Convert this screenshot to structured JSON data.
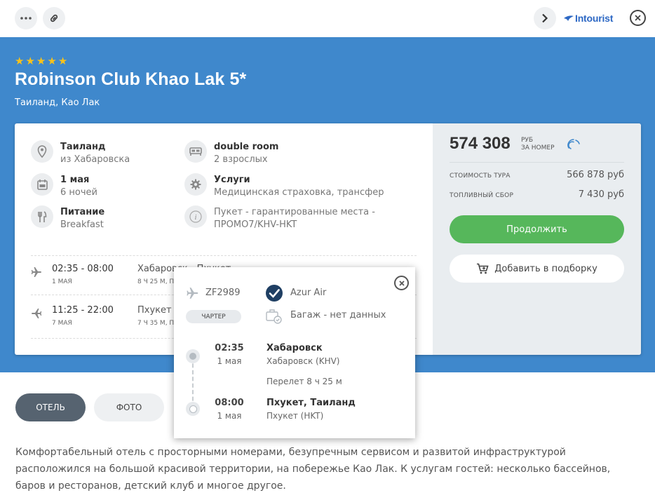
{
  "topbar": {
    "brand": "Intourist",
    "icons": [
      "more-icon",
      "link-icon",
      "chevron-right-icon",
      "close-icon"
    ]
  },
  "hotel": {
    "stars": [
      "★",
      "★",
      "★",
      "★",
      "★"
    ],
    "name": "Robinson Club Khao Lak 5*",
    "location": "Таиланд, Као Лак"
  },
  "info": {
    "country": {
      "title": "Таиланд",
      "sub": "из Хабаровска"
    },
    "room": {
      "title": "double room",
      "sub": "2 взрослых"
    },
    "date": {
      "title": "1 мая",
      "sub": "6 ночей"
    },
    "services": {
      "title": "Услуги",
      "sub": "Медицинская страховка, трансфер"
    },
    "meal": {
      "title": "Питание",
      "sub": "Breakfast"
    },
    "note": {
      "sub": "Пукет - гарантированные места - ПРОМО7/KHV-HKT"
    }
  },
  "flights": [
    {
      "time": "02:35 - 08:00",
      "date": "1 МАЯ",
      "route": "Хабаровск - Пхукет",
      "duration": "8 Ч 25 М, ПЕРЕЛЕТ",
      "airline": "Azur Air"
    },
    {
      "time": "11:25 - 22:00",
      "date": "7 МАЯ",
      "route": "Пхукет - Хабаровск",
      "duration": "7 Ч 35 М, ПЕРЕЛЕТ",
      "airline": "Azur Air"
    }
  ],
  "price": {
    "total": "574 308",
    "currency": "РУБ",
    "per": "ЗА НОМЕР",
    "tour_label": "СТОИМОСТЬ ТУРА",
    "tour_value": "566 878 руб",
    "fuel_label": "ТОПЛИВНЫЙ СБОР",
    "fuel_value": "7 430 руб",
    "continue_label": "Продолжить",
    "add_label": "Добавить в подборку"
  },
  "tabs": [
    {
      "label": "ОТЕЛЬ",
      "active": true
    },
    {
      "label": "ФОТО",
      "active": false
    }
  ],
  "description": "Комфортабельный отель с просторными номерами, безупречным сервисом и развитой инфраструктурой расположился на большой красивой территории, на побережье Као Лак. К услугам гостей: несколько бассейнов, баров и ресторанов, детский клуб и многое другое.",
  "popup": {
    "flight_no": "ZF2989",
    "type": "ЧАРТЕР",
    "airline": "Azur Air",
    "baggage": "Багаж - нет данных",
    "departure": {
      "time": "02:35",
      "date": "1 мая",
      "city": "Хабаровск",
      "airport": "Хабаровск (KHV)"
    },
    "transit": "Перелет  8 ч 25 м",
    "arrival": {
      "time": "08:00",
      "date": "1 мая",
      "city": "Пхукет, Таиланд",
      "airport": "Пхукет (HKT)"
    }
  },
  "colors": {
    "hero": "#3f88cc",
    "accent_green": "#56b75b",
    "star": "#f7c21b",
    "tab_active": "#566370"
  }
}
